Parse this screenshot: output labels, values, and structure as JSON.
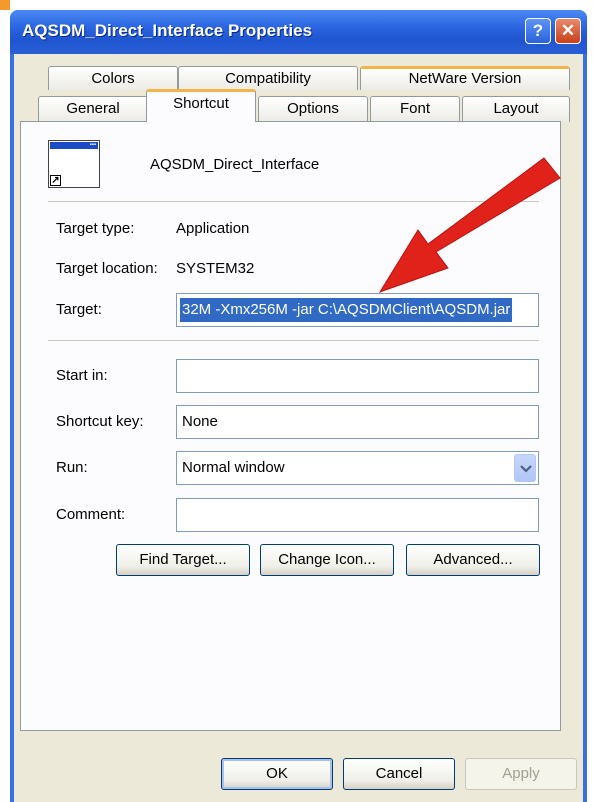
{
  "window": {
    "title": "AQSDM_Direct_Interface Properties",
    "help_label": "?",
    "close_label": "✕"
  },
  "tabs_row1": [
    {
      "label": "Colors"
    },
    {
      "label": "Compatibility"
    },
    {
      "label": "NetWare Version"
    }
  ],
  "tabs_row2": [
    {
      "label": "General"
    },
    {
      "label": "Shortcut"
    },
    {
      "label": "Options"
    },
    {
      "label": "Font"
    },
    {
      "label": "Layout"
    }
  ],
  "active_tab": "Shortcut",
  "shortcut": {
    "app_name": "AQSDM_Direct_Interface",
    "target_type_label": "Target type:",
    "target_type_value": "Application",
    "target_location_label": "Target location:",
    "target_location_value": "SYSTEM32",
    "target_label": "Target:",
    "target_value": "32M -Xmx256M -jar C:\\AQSDMClient\\AQSDM.jar",
    "start_in_label": "Start in:",
    "start_in_value": "",
    "shortcut_key_label": "Shortcut key:",
    "shortcut_key_value": "None",
    "run_label": "Run:",
    "run_value": "Normal window",
    "comment_label": "Comment:",
    "comment_value": ""
  },
  "buttons": {
    "find_target": "Find Target...",
    "change_icon": "Change Icon...",
    "advanced": "Advanced...",
    "ok": "OK",
    "cancel": "Cancel",
    "apply": "Apply"
  },
  "colors": {
    "title_bar": "#2a64e0",
    "dialog_bg": "#ece9d8",
    "selection": "#316ac5",
    "annotation_arrow": "#e0221b"
  },
  "icons": {
    "app": "app-window-icon",
    "dropdown": "chevron-down-icon",
    "annotation": "red-arrow-annotation"
  }
}
